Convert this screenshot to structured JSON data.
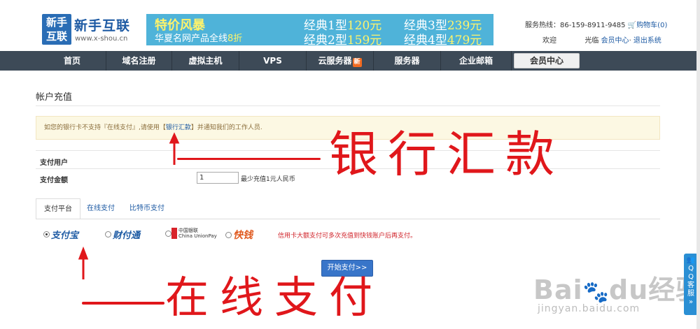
{
  "header": {
    "logo_mark": "新手\n互联",
    "logo_name": "新手互联",
    "logo_url": "www.x-shou.cn",
    "banner": {
      "title": "特价风暴",
      "subtitle_prefix": "华夏名网产品全线",
      "subtitle_discount": "8折",
      "promos": [
        {
          "label": "经典1型",
          "price": "120元"
        },
        {
          "label": "经典3型",
          "price": "239元"
        },
        {
          "label": "经典2型",
          "price": "159元"
        },
        {
          "label": "经典4型",
          "price": "479元"
        }
      ]
    },
    "hotline": "服务热线：86-159-8911-9485",
    "cart": "购物车(0)",
    "welcome": "欢迎",
    "welcome_suffix": "光临",
    "member_center": "会员中心",
    "logout": "退出系统"
  },
  "nav": {
    "items": [
      {
        "label": "首页"
      },
      {
        "label": "域名注册"
      },
      {
        "label": "虚拟主机"
      },
      {
        "label": "VPS"
      },
      {
        "label": "云服务器",
        "badge": "新"
      },
      {
        "label": "服务器"
      },
      {
        "label": "企业邮箱"
      },
      {
        "label": "会员中心"
      }
    ]
  },
  "page": {
    "title": "帐户充值",
    "notice_prefix": "如您的银行卡不支持『在线支付』,请使用【",
    "notice_link": "银行汇款",
    "notice_suffix": "】并通知我们的工作人员.",
    "fields": {
      "user_label": "支付用户",
      "amount_label": "支付金额",
      "amount_value": "1",
      "amount_hint": "最少充值1元人民币"
    },
    "tabs": [
      {
        "label": "支付平台"
      },
      {
        "label": "在线支付"
      },
      {
        "label": "比特币支付"
      }
    ],
    "pay_options": {
      "alipay": "支付宝",
      "tenpay": "财付通",
      "unionpay": "中国银联\nChina UnionPay",
      "kuaiqian": "快钱",
      "note": "信用卡大额支付可多次充值到快钱账户后再支付。"
    },
    "submit": "开始支付>>"
  },
  "annotations": {
    "bank_transfer": "银行汇款",
    "online_pay": "在线支付"
  },
  "side_widget": {
    "chars": [
      "Q",
      "Q",
      "客",
      "服"
    ]
  },
  "watermark": {
    "main_a": "Bai",
    "main_b": "du",
    "main_c": "经验",
    "sub": "jingyan.baidu.com"
  }
}
